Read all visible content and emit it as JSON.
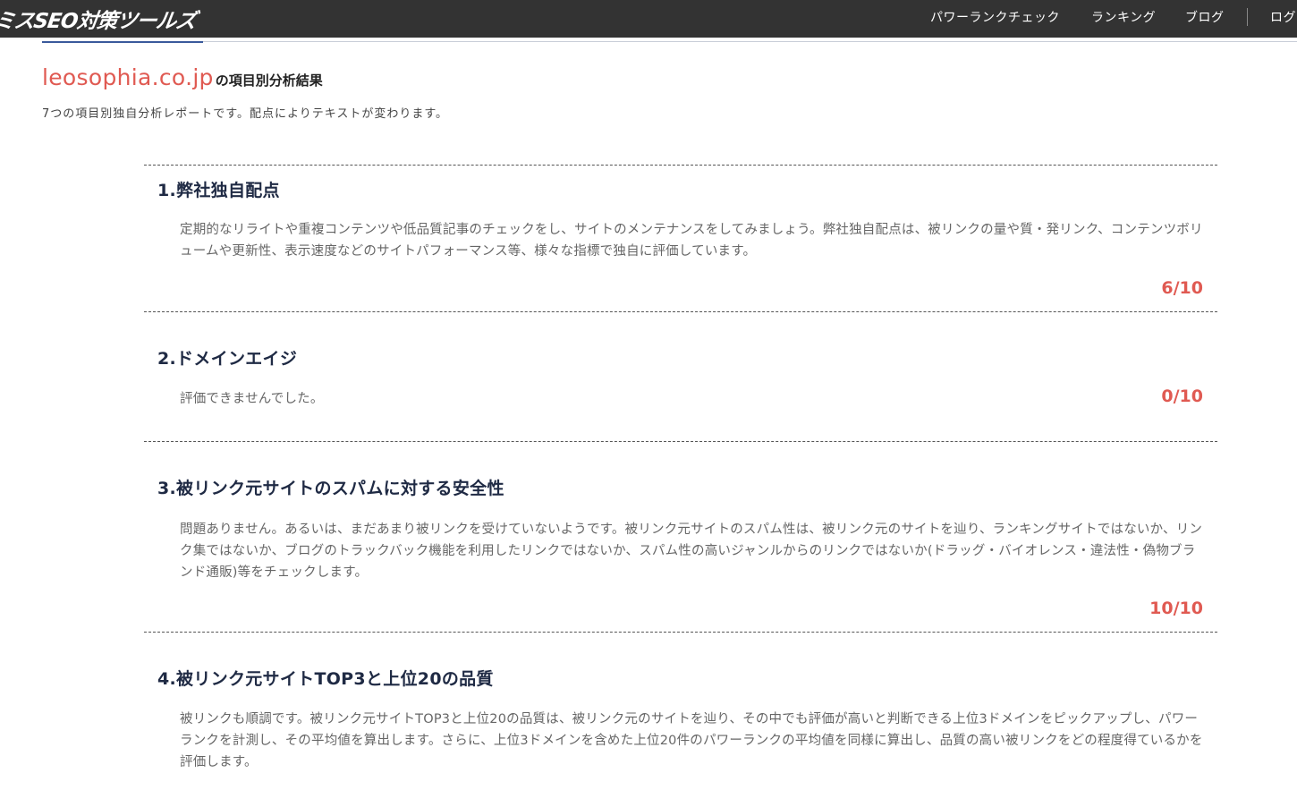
{
  "header": {
    "logo_text": "ミスSEO対策ツールズ",
    "nav": [
      "パワーランクチェック",
      "ランキング",
      "ブログ",
      "ログ"
    ]
  },
  "heading": {
    "domain": "leosophia.co.jp",
    "suffix": "の項目別分析結果",
    "subtitle": "7つの項目別独自分析レポートです。配点によりテキストが変わります。"
  },
  "sections": [
    {
      "title": "1.弊社独自配点",
      "body": "定期的なリライトや重複コンテンツや低品質記事のチェックをし、サイトのメンテナンスをしてみましょう。弊社独自配点は、被リンクの量や質・発リンク、コンテンツボリュームや更新性、表示速度などのサイトパフォーマンス等、様々な指標で独自に評価しています。",
      "score": "6/10"
    },
    {
      "title": "2.ドメインエイジ",
      "body": "評価できませんでした。",
      "score": "0/10"
    },
    {
      "title": "3.被リンク元サイトのスパムに対する安全性",
      "body": "問題ありません。あるいは、まだあまり被リンクを受けていないようです。被リンク元サイトのスパム性は、被リンク元のサイトを辿り、ランキングサイトではないか、リンク集ではないか、ブログのトラックバック機能を利用したリンクではないか、スパム性の高いジャンルからのリンクではないか(ドラッグ・バイオレンス・違法性・偽物ブランド通販)等をチェックします。",
      "score": "10/10"
    },
    {
      "title": "4.被リンク元サイトTOP3と上位20の品質",
      "body": "被リンクも順調です。被リンク元サイトTOP3と上位20の品質は、被リンク元のサイトを辿り、その中でも評価が高いと判断できる上位3ドメインをピックアップし、パワーランクを計測し、その平均値を算出します。さらに、上位3ドメインを含めた上位20件のパワーランクの平均値を同様に算出し、品質の高い被リンクをどの程度得ているかを評価します。",
      "score": ""
    }
  ],
  "colors": {
    "topbar": "#333333",
    "accent_red": "#e05a52",
    "title_navy": "#1f2a44",
    "tab_blue": "#3a5a9c"
  }
}
